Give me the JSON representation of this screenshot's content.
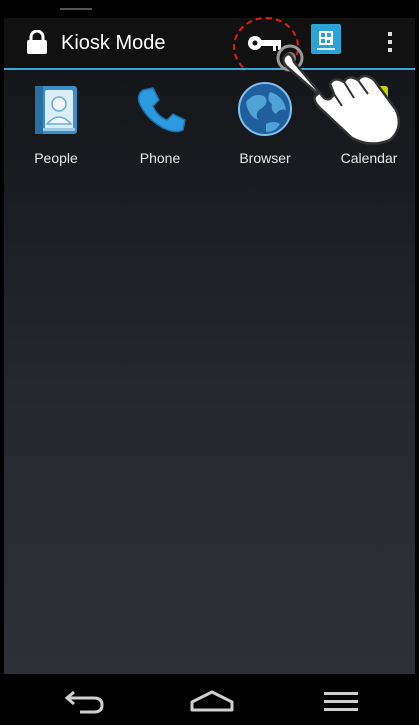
{
  "action_bar": {
    "title": "Kiosk Mode",
    "lock_icon": "lock-icon",
    "key_icon": "key-icon",
    "qr_icon": "qr-code-icon",
    "overflow_icon": "overflow-menu-icon",
    "accent_color": "#3aa8d8",
    "highlight_color": "#e01b1b"
  },
  "apps": [
    {
      "label": "People",
      "icon": "people-icon"
    },
    {
      "label": "Phone",
      "icon": "phone-icon"
    },
    {
      "label": "Browser",
      "icon": "browser-icon"
    },
    {
      "label": "Calendar",
      "icon": "calendar-icon"
    }
  ],
  "overlay": {
    "pointer": "hand-pointer-icon"
  },
  "nav_bar": {
    "back_icon": "back-icon",
    "home_icon": "home-icon",
    "recents_icon": "recents-icon"
  }
}
